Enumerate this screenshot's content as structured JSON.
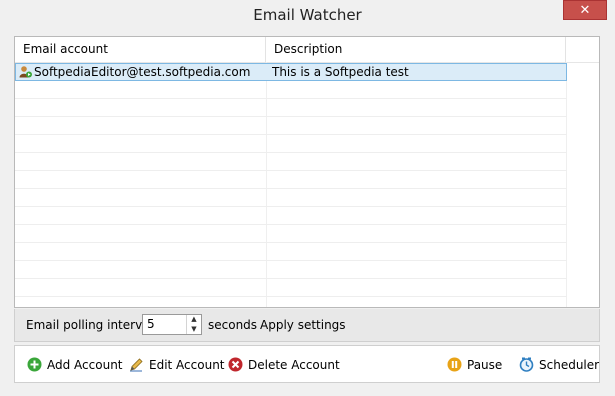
{
  "window": {
    "title": "Email Watcher",
    "close_glyph": "✕"
  },
  "table": {
    "columns": [
      "Email account",
      "Description"
    ],
    "rows": [
      {
        "account": "SoftpediaEditor@test.softpedia.com",
        "description": "This is a Softpedia test"
      }
    ]
  },
  "polling": {
    "label": "Email polling interval:",
    "value": "5",
    "unit": "seconds",
    "apply_label": "Apply settings"
  },
  "toolbar": {
    "add_label": "Add Account",
    "edit_label": "Edit Account",
    "delete_label": "Delete Account",
    "pause_label": "Pause",
    "scheduler_label": "Scheduler"
  },
  "icons": {
    "add": "plus-circle-icon",
    "edit": "pencil-icon",
    "delete": "x-circle-icon",
    "pause": "pause-icon",
    "scheduler": "clock-icon",
    "account": "user-mail-icon"
  },
  "colors": {
    "selection": "#dbecf8",
    "close": "#c7504b",
    "add": "#3aa63a",
    "delete": "#c0272d",
    "pause": "#e8a317",
    "scheduler": "#2f7fc1"
  }
}
